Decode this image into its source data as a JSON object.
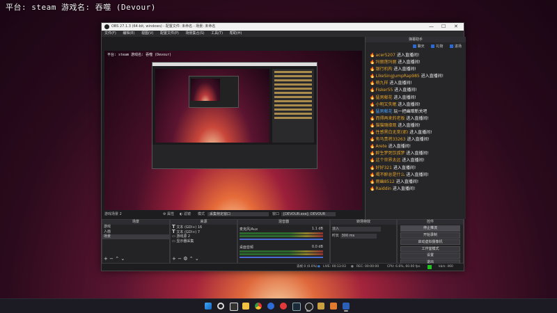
{
  "overlay": {
    "text": "平台: steam   游戏名: 吞噬 (Devour)"
  },
  "obs": {
    "title": "OBS 27.1.3 (64-bit, windows) - 配置文件: 未命名 - 场景: 未命名",
    "window_controls": [
      "—",
      "☐",
      "✕"
    ],
    "menu": [
      "文件(F)",
      "编辑(E)",
      "视图(V)",
      "配置文件(P)",
      "场景集合(S)",
      "工具(T)",
      "帮助(H)"
    ],
    "preview_overlay_text": "平台: steam  游戏名: 吞噬 (Devour)",
    "chat": {
      "title": "弹幕助手",
      "options": [
        "聊天",
        "礼物",
        "进场"
      ],
      "lines": [
        {
          "user": "acer5207",
          "text": "进入直播间!",
          "blue": false
        },
        {
          "user": "玛丽莲玛丽",
          "text": "进入直播间!",
          "blue": false
        },
        {
          "user": "银行机构",
          "text": "进入直播间!",
          "blue": false
        },
        {
          "user": "LikeSingJumpRap985",
          "text": "进入直播间!",
          "blue": false
        },
        {
          "user": "萌九样",
          "text": "进入直播间!",
          "blue": false
        },
        {
          "user": "Fisker55",
          "text": "进入直播间!",
          "blue": false
        },
        {
          "user": "猛男献花",
          "text": "进入直播间!",
          "blue": false
        },
        {
          "user": "小明又失眠",
          "text": "进入直播间!",
          "blue": false
        },
        {
          "user": "猛男献花",
          "text": "玩一把幽暗新关吧",
          "blue": true
        },
        {
          "user": "而得再来的老板",
          "text": "进入直播间!",
          "blue": false
        },
        {
          "user": "猫猫随缘观",
          "text": "进入直播间!",
          "blue": false
        },
        {
          "user": "性感黑白无常(邪)",
          "text": "进入直播间!",
          "blue": false
        },
        {
          "user": "有马贵将33263",
          "text": "进入直播间!",
          "blue": false
        },
        {
          "user": "Arete",
          "text": "进入直播间!",
          "blue": false
        },
        {
          "user": "醉生梦死饮孤梦",
          "text": "进入直播间!",
          "blue": false
        },
        {
          "user": "这个世界太远",
          "text": "进入直播间!",
          "blue": false
        },
        {
          "user": "好好321",
          "text": "进入直播间!",
          "blue": false
        },
        {
          "user": "喝不醉总是什么",
          "text": "进入直播间!",
          "blue": false
        },
        {
          "user": "雨幽8512",
          "text": "进入直播间!",
          "blue": false
        },
        {
          "user": "Raiddin",
          "text": "进入直播间!",
          "blue": false
        }
      ]
    },
    "scenebar": {
      "scene": "游戏场景 2",
      "props_btn": "属性",
      "filters_btn": "滤镜",
      "mode_label": "模式",
      "mode_value": "采集特定窗口",
      "window_label": "窗口",
      "window_value": "[DEVOUR.exe]: DEVOUR"
    },
    "scenes": {
      "header": "场景",
      "items": [
        "游戏",
        "入画",
        "场景"
      ]
    },
    "sources": {
      "header": "来源",
      "items": [
        "文本 (GDI+) 16",
        "文本 (GDI+) 7",
        "游戏源 2",
        "显示器采集"
      ]
    },
    "mixer": {
      "header": "混音器",
      "channels": [
        {
          "name": "麦克风/Aux",
          "db": "1.1 dB"
        },
        {
          "name": "桌面音频",
          "db": "0.0 dB"
        }
      ]
    },
    "transitions": {
      "header": "转场特效",
      "type": "淡入",
      "duration_label": "时长",
      "duration": "300 ms"
    },
    "controls": {
      "header": "控件",
      "buttons": [
        "停止推流",
        "开始录制",
        "启动虚拟摄像机",
        "工作室模式",
        "设置",
        "退出"
      ]
    },
    "status": {
      "dropped": "丢帧 0 (0.0%)",
      "live": "LIVE: 00:13:03",
      "rec": "REC: 00:00:00",
      "cpu": "CPU: 6.6%, 60.00 fps",
      "kbps": "kb/s: 460"
    }
  },
  "taskbar": {
    "icons": [
      "windows-icon",
      "search-icon",
      "taskview-icon",
      "explorer-icon",
      "chrome-icon",
      "netease-icon",
      "music-icon",
      "steam-icon",
      "obs-icon",
      "app-icon",
      "app2-icon",
      "steam2-icon"
    ]
  }
}
